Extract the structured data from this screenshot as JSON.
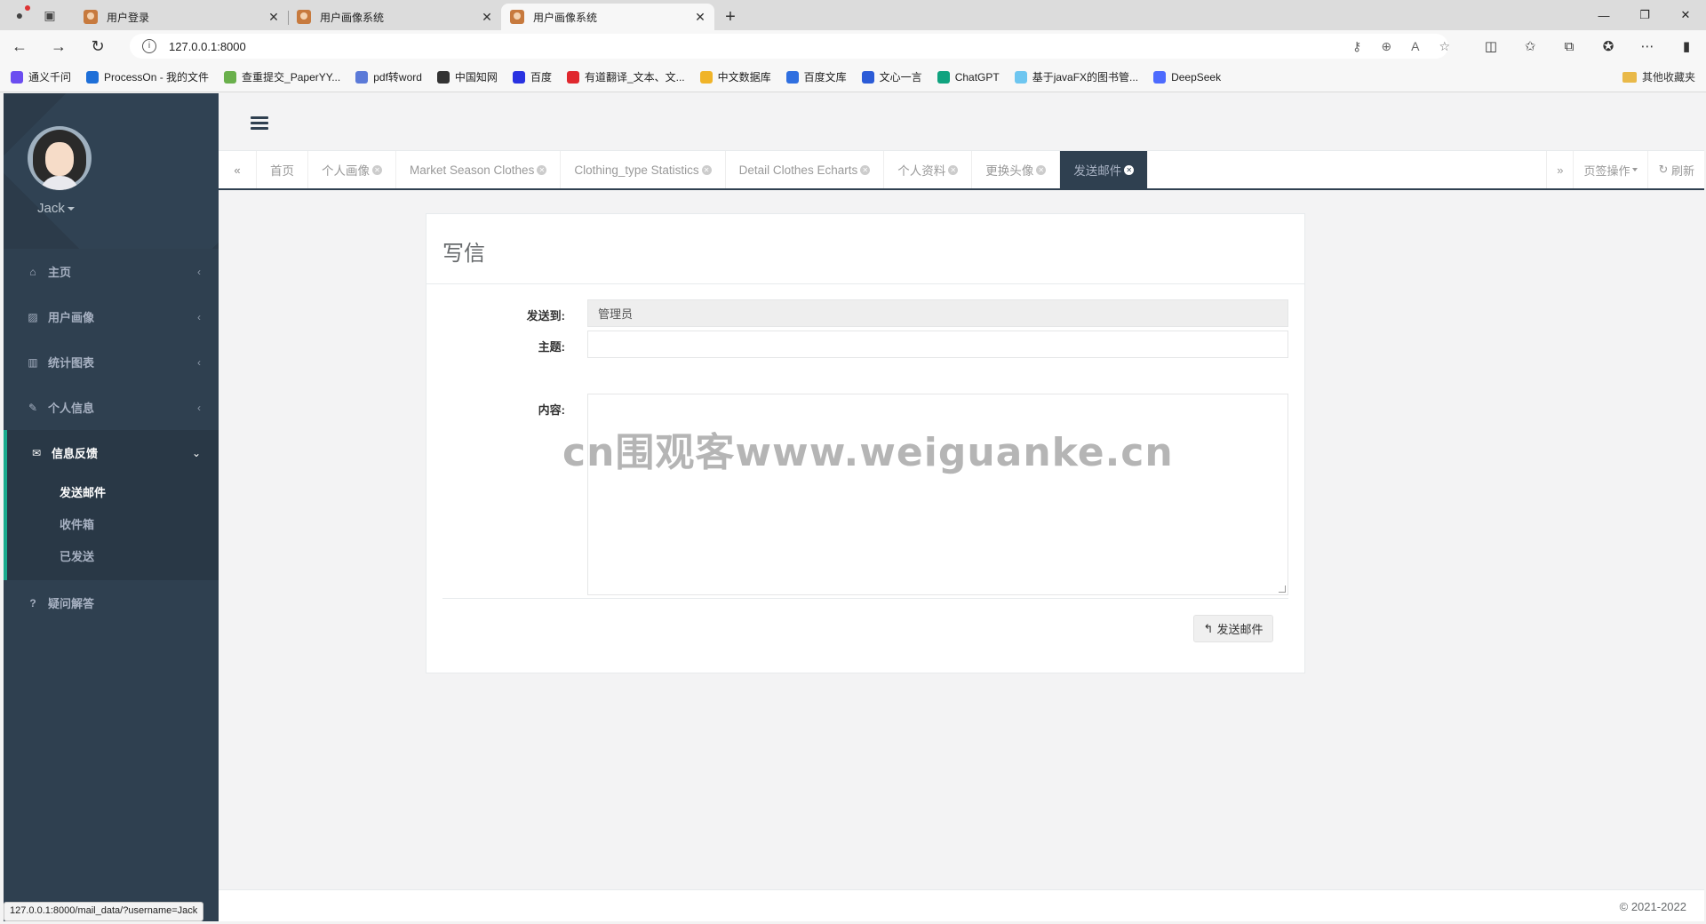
{
  "browser": {
    "tabs": [
      {
        "title": "用户登录"
      },
      {
        "title": "用户画像系统"
      },
      {
        "title": "用户画像系统"
      }
    ],
    "url": "127.0.0.1:8000",
    "bookmarks": [
      {
        "label": "通义千问",
        "color": "#6b4df0"
      },
      {
        "label": "ProcessOn - 我的文件",
        "color": "#1e6fd8"
      },
      {
        "label": "查重提交_PaperYY...",
        "color": "#6ab04c"
      },
      {
        "label": "pdf转word",
        "color": "#5b7ad8"
      },
      {
        "label": "中国知网",
        "color": "#333333"
      },
      {
        "label": "百度",
        "color": "#2932e1"
      },
      {
        "label": "有道翻译_文本、文...",
        "color": "#e0282e"
      },
      {
        "label": "中文数据库",
        "color": "#f0b429"
      },
      {
        "label": "百度文库",
        "color": "#2f6fe0"
      },
      {
        "label": "文心一言",
        "color": "#2b5bd7"
      },
      {
        "label": "ChatGPT",
        "color": "#10a37f"
      },
      {
        "label": "基于javaFX的图书管...",
        "color": "#6ec6f0"
      },
      {
        "label": "DeepSeek",
        "color": "#4d6bfe"
      }
    ],
    "other_bookmarks": "其他收藏夹",
    "status_url": "127.0.0.1:8000/mail_data/?username=Jack"
  },
  "sidebar": {
    "username": "Jack",
    "items": [
      {
        "label": "主页",
        "icon": "home-icon"
      },
      {
        "label": "用户画像",
        "icon": "picture-icon"
      },
      {
        "label": "统计图表",
        "icon": "bar-chart-icon"
      },
      {
        "label": "个人信息",
        "icon": "edit-icon"
      }
    ],
    "active_group": {
      "label": "信息反馈",
      "icon": "envelope-icon",
      "subitems": [
        {
          "label": "发送邮件"
        },
        {
          "label": "收件箱"
        },
        {
          "label": "已发送"
        }
      ]
    },
    "faq": "疑问解答"
  },
  "page_tabs": [
    {
      "label": "首页",
      "closable": false
    },
    {
      "label": "个人画像",
      "closable": true
    },
    {
      "label": "Market Season Clothes",
      "closable": true
    },
    {
      "label": "Clothing_type Statistics",
      "closable": true
    },
    {
      "label": "Detail Clothes Echarts",
      "closable": true
    },
    {
      "label": "个人资料",
      "closable": true
    },
    {
      "label": "更换头像",
      "closable": true
    },
    {
      "label": "发送邮件",
      "closable": true
    }
  ],
  "tab_ops": {
    "label": "页签操作",
    "refresh": "刷新"
  },
  "mail": {
    "title": "写信",
    "to_label": "发送到:",
    "to_value": "管理员",
    "subject_label": "主题:",
    "subject_value": "",
    "content_label": "内容:",
    "content_value": "",
    "send_button": "发送邮件"
  },
  "watermark": "cn围观客www.weiguanke.cn",
  "footer": "© 2021-2022",
  "colors": {
    "sidebar": "#2f4050",
    "accent": "#19aa8d"
  }
}
